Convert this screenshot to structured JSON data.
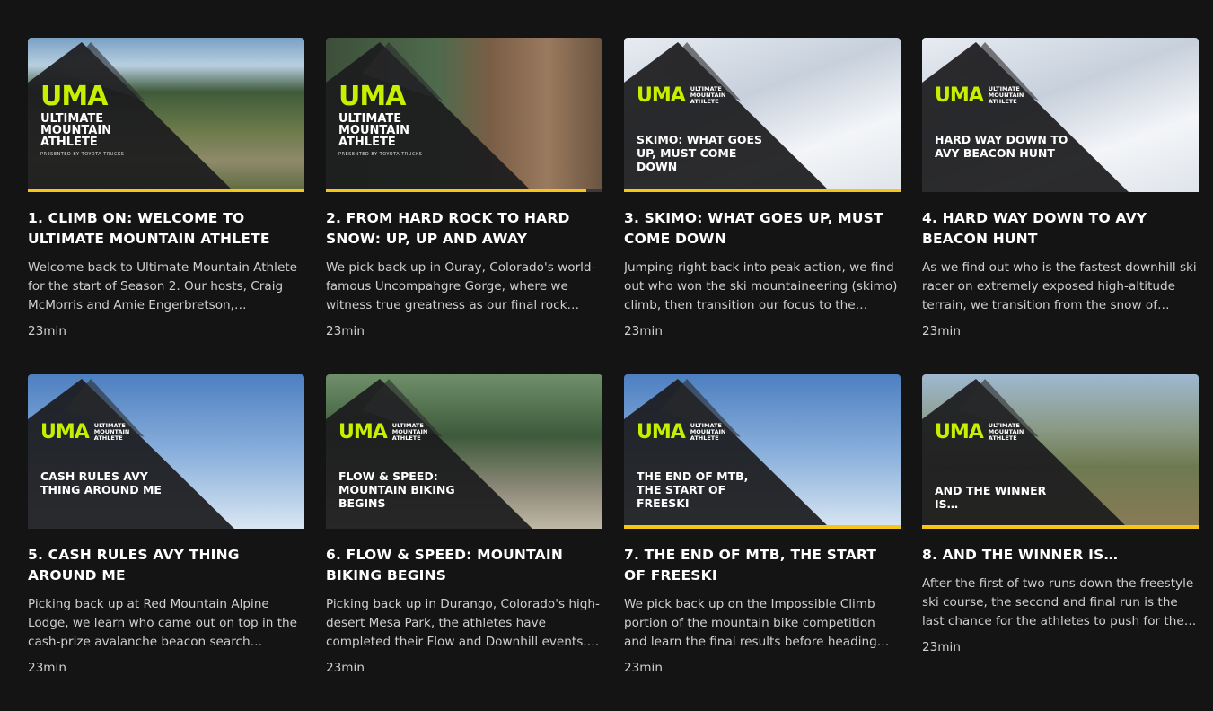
{
  "colors": {
    "background": "#141414",
    "progress": "#f5c518",
    "logo_accent": "#c6f000"
  },
  "logo": {
    "mark": "UMA",
    "wordmark": "ULTIMATE MOUNTAIN ATHLETE",
    "presented_by": "PRESENTED BY TOYOTA TRUCKS"
  },
  "episodes": [
    {
      "title": "1. Climb On: Welcome to Ultimate Mountain Athlete",
      "overlay": "",
      "description": "Welcome back to Ultimate Mountain Athlete for the start of Season 2. Our hosts, Craig McMorris and Amie Engerbretson, welcome…",
      "duration": "23min",
      "progress": 1.0,
      "scene": "road"
    },
    {
      "title": "2. From Hard Rock to Hard Snow: Up, Up and Away",
      "overlay": "",
      "description": "We pick back up in Ouray, Colorado's world-famous Uncompahgre Gorge, where we witness true greatness as our final rock…",
      "duration": "23min",
      "progress": 0.94,
      "scene": "rock"
    },
    {
      "title": "3. SKIMO: What Goes Up, Must Come Down",
      "overlay": "SKIMO: WHAT GOES UP, MUST COME DOWN",
      "description": "Jumping right back into peak action, we find out who won the ski mountaineering (skimo) climb, then transition our focus to the descen…",
      "duration": "23min",
      "progress": 1.0,
      "scene": "snow"
    },
    {
      "title": "4. Hard Way Down to Avy Beacon Hunt",
      "overlay": "HARD WAY DOWN TO AVY BEACON HUNT",
      "description": "As we find out who is the fastest downhill ski racer on extremely exposed high-altitude terrain, we transition from the snow of Silverto…",
      "duration": "23min",
      "progress": 0,
      "scene": "snow"
    },
    {
      "title": "5. Cash Rules Avy Thing Around Me",
      "overlay": "CASH RULES AVY THING AROUND ME",
      "description": "Picking back up at Red Mountain Alpine Lodge, we learn who came out on top in the cash-prize avalanche beacon search competition. After…",
      "duration": "23min",
      "progress": 0,
      "scene": "sky"
    },
    {
      "title": "6. Flow & Speed: Mountain Biking Begins",
      "overlay": "FLOW & SPEED: MOUNTAIN BIKING BEGINS",
      "description": "Picking back up in Durango, Colorado's high-desert Mesa Park, the athletes have completed their Flow and Downhill events. W…",
      "duration": "23min",
      "progress": 0,
      "scene": "forest"
    },
    {
      "title": "7. The End of MTB, the Start of Freeski",
      "overlay": "THE END OF MTB, THE START OF FREESKI",
      "description": "We pick back up on the Impossible Climb portion of the mountain bike competition and learn the final results before heading back to…",
      "duration": "23min",
      "progress": 1.0,
      "scene": "sky"
    },
    {
      "title": "8. And the Winner Is…",
      "overlay": "AND THE WINNER IS…",
      "description": "After the first of two runs down the freestyle ski course, the second and final run is the last chance for the athletes to push for the UMA…",
      "duration": "23min",
      "progress": 1.0,
      "scene": "valley"
    }
  ]
}
